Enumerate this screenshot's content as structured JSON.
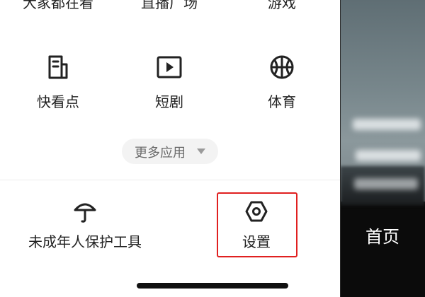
{
  "menu": {
    "top_row": [
      {
        "label": "大家都在看"
      },
      {
        "label": "直播广场"
      },
      {
        "label": "游戏"
      }
    ],
    "grid": [
      {
        "label": "快看点",
        "icon": "article-icon"
      },
      {
        "label": "短剧",
        "icon": "play-video-icon"
      },
      {
        "label": "体育",
        "icon": "basketball-icon"
      }
    ],
    "more_apps_label": "更多应用",
    "bottom": [
      {
        "label": "未成年人保护工具",
        "icon": "umbrella-icon"
      },
      {
        "label": "设置",
        "icon": "settings-hexagon-icon"
      }
    ]
  },
  "side": {
    "tab_label": "首页"
  },
  "colors": {
    "text": "#222222",
    "muted": "#6b6b6b",
    "pill_bg": "#f3f3f3",
    "highlight": "#e02020",
    "side_bg": "#0b0b0b"
  }
}
